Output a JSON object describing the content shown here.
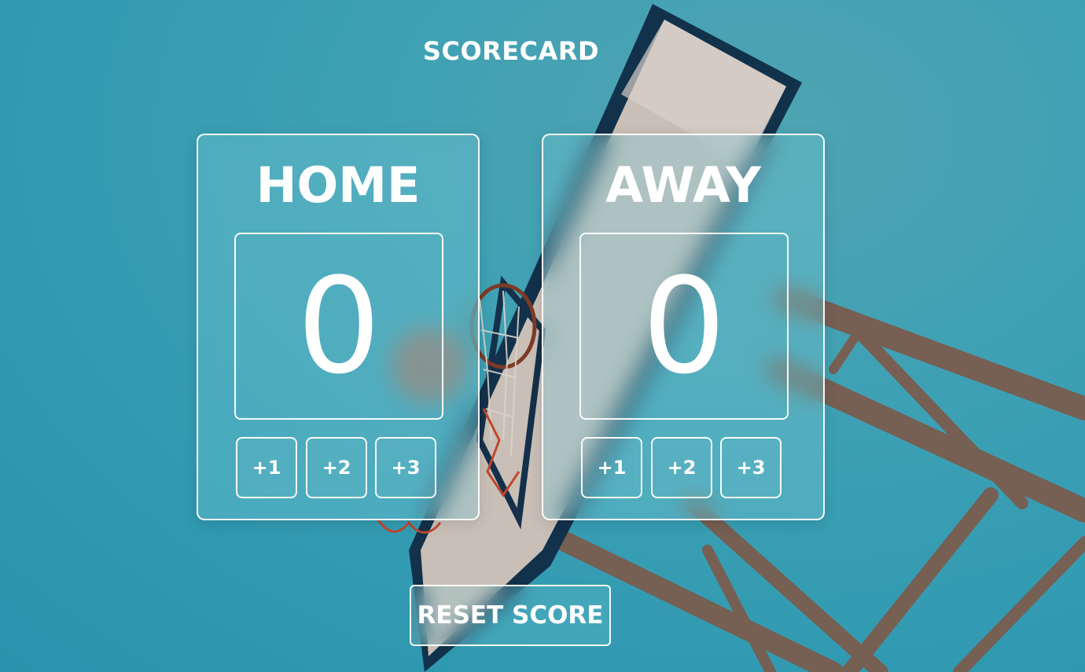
{
  "app": {
    "title": "SCORECARD"
  },
  "background": {
    "image": "basketball-hoop-photo",
    "sky_color": "#3aa0b5"
  },
  "teams": [
    {
      "name": "HOME",
      "score": "0",
      "buttons": [
        "+1",
        "+2",
        "+3"
      ]
    },
    {
      "name": "AWAY",
      "score": "0",
      "buttons": [
        "+1",
        "+2",
        "+3"
      ]
    }
  ],
  "controls": {
    "reset_label": "RESET SCORE"
  }
}
